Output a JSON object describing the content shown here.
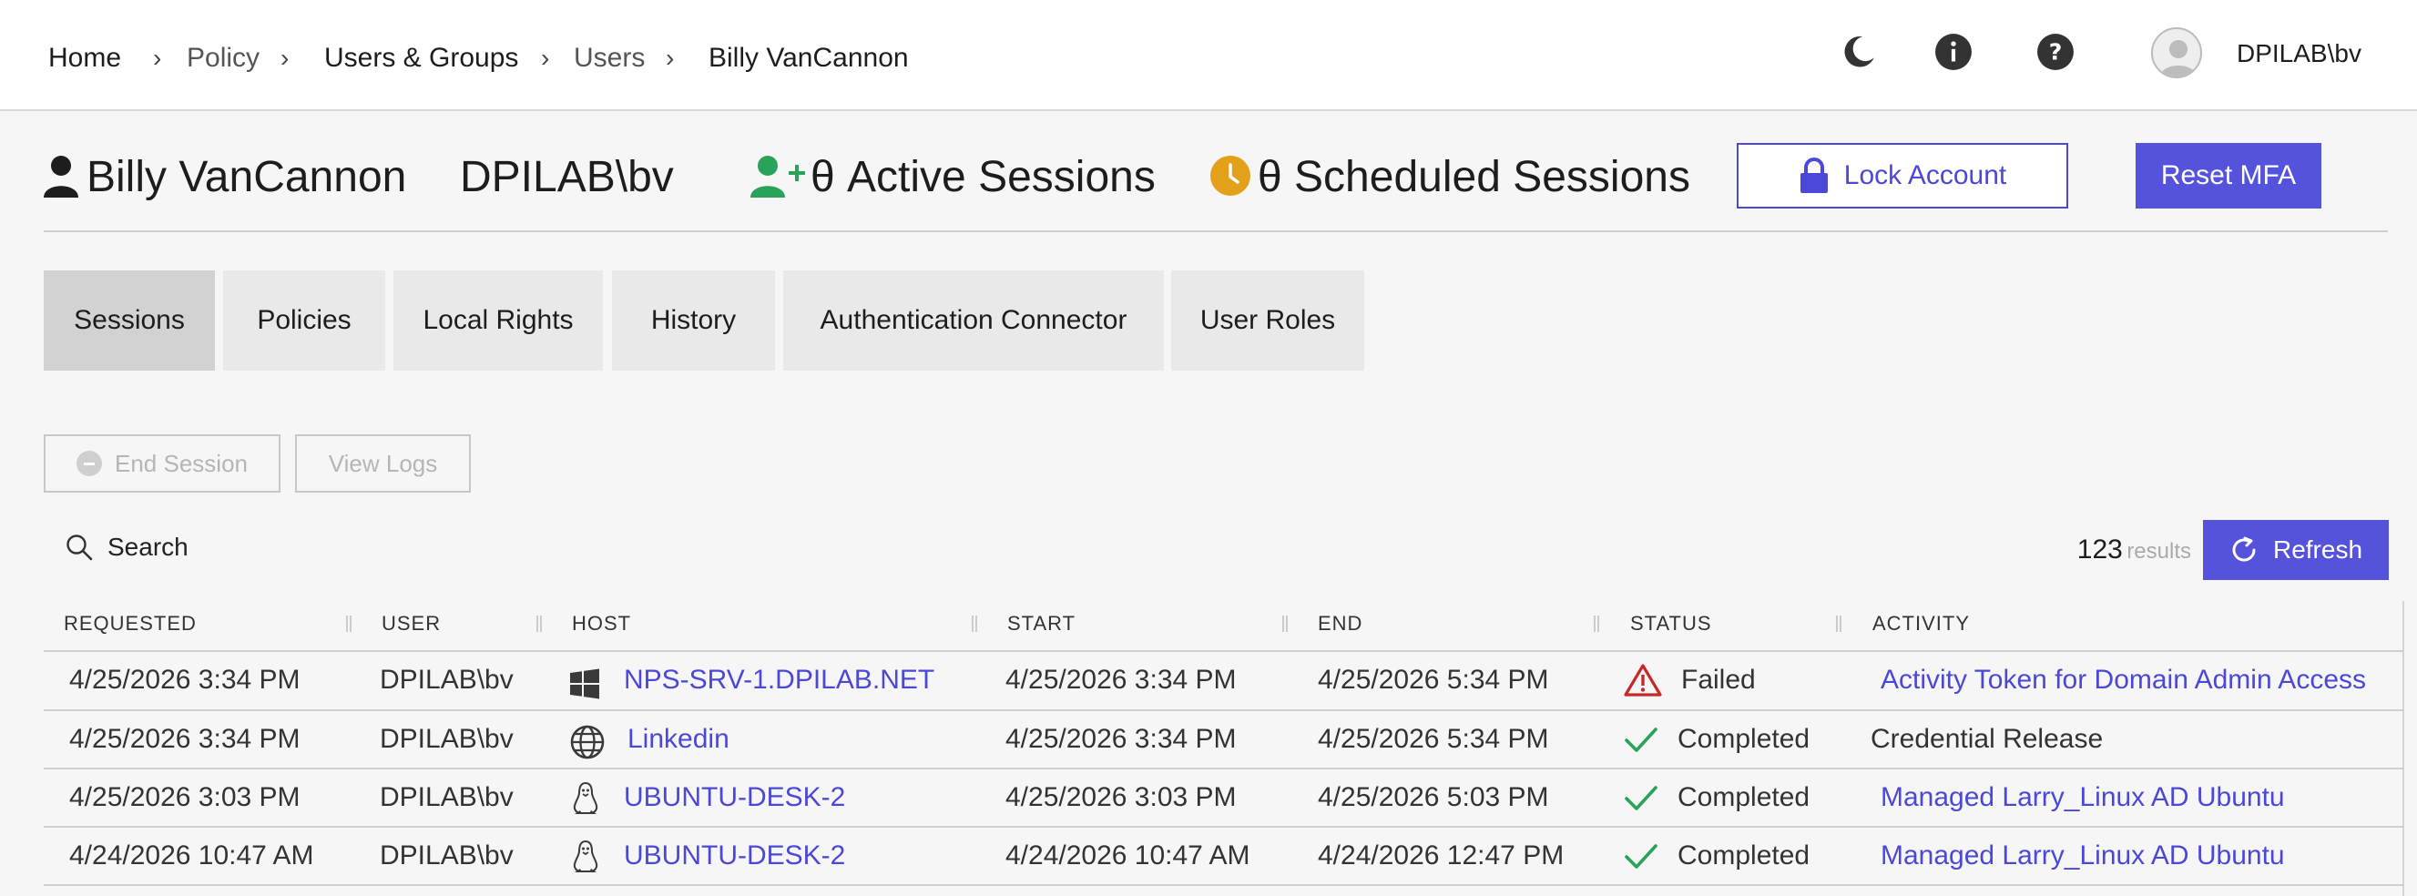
{
  "breadcrumb": {
    "home": "Home",
    "policy": "Policy",
    "users_groups": "Users & Groups",
    "users": "Users",
    "current": "Billy VanCannon"
  },
  "top_icons": [
    "moon-icon",
    "info-icon",
    "help-icon"
  ],
  "account": {
    "username": "DPILAB\\bv"
  },
  "header": {
    "name": "Billy VanCannon",
    "account": "DPILAB\\bv",
    "active_sessions": "θ Active Sessions",
    "scheduled_sessions": "θ Scheduled Sessions",
    "lock_label": "Lock Account",
    "mfa_label": "Reset MFA"
  },
  "tabs": [
    "Sessions",
    "Policies",
    "Local Rights",
    "History",
    "Authentication Connector",
    "User Roles"
  ],
  "actions": {
    "end_session": "End Session",
    "view_logs": "View Logs"
  },
  "search": {
    "placeholder": "Search"
  },
  "results": {
    "count": "123",
    "label": "results"
  },
  "refresh_label": "Refresh",
  "table": {
    "columns": [
      "REQUESTED",
      "USER",
      "HOST",
      "START",
      "END",
      "STATUS",
      "ACTIVITY"
    ],
    "rows": [
      {
        "requested": "4/25/2026 3:34 PM",
        "user": "DPILAB\\bv",
        "host": "NPS-SRV-1.DPILAB.NET",
        "host_icon": "windows-icon",
        "start": "4/25/2026 3:34 PM",
        "end": "4/25/2026 5:34 PM",
        "status": "Failed",
        "status_icon": "warning-icon",
        "activity": "Activity Token for Domain Admin Access",
        "activity_link": true
      },
      {
        "requested": "4/25/2026 3:34 PM",
        "user": "DPILAB\\bv",
        "host": "Linkedin",
        "host_icon": "globe-icon",
        "start": "4/25/2026 3:34 PM",
        "end": "4/25/2026 5:34 PM",
        "status": "Completed",
        "status_icon": "check-icon",
        "activity": "Credential Release",
        "activity_link": false
      },
      {
        "requested": "4/25/2026 3:03 PM",
        "user": "DPILAB\\bv",
        "host": "UBUNTU-DESK-2",
        "host_icon": "linux-icon",
        "start": "4/25/2026 3:03 PM",
        "end": "4/25/2026 5:03 PM",
        "status": "Completed",
        "status_icon": "check-icon",
        "activity": "Managed Larry_Linux AD Ubuntu",
        "activity_link": true
      },
      {
        "requested": "4/24/2026 10:47 AM",
        "user": "DPILAB\\bv",
        "host": "UBUNTU-DESK-2",
        "host_icon": "linux-icon",
        "start": "4/24/2026 10:47 AM",
        "end": "4/24/2026 12:47 PM",
        "status": "Completed",
        "status_icon": "check-icon",
        "activity": "Managed Larry_Linux AD Ubuntu",
        "activity_link": true
      }
    ]
  },
  "colors": {
    "accent": "#5552dc",
    "link": "#4b48d8",
    "success": "#2aa35a",
    "error": "#c62828",
    "user_add": "#2aa35a",
    "clock": "#e3a11b"
  }
}
